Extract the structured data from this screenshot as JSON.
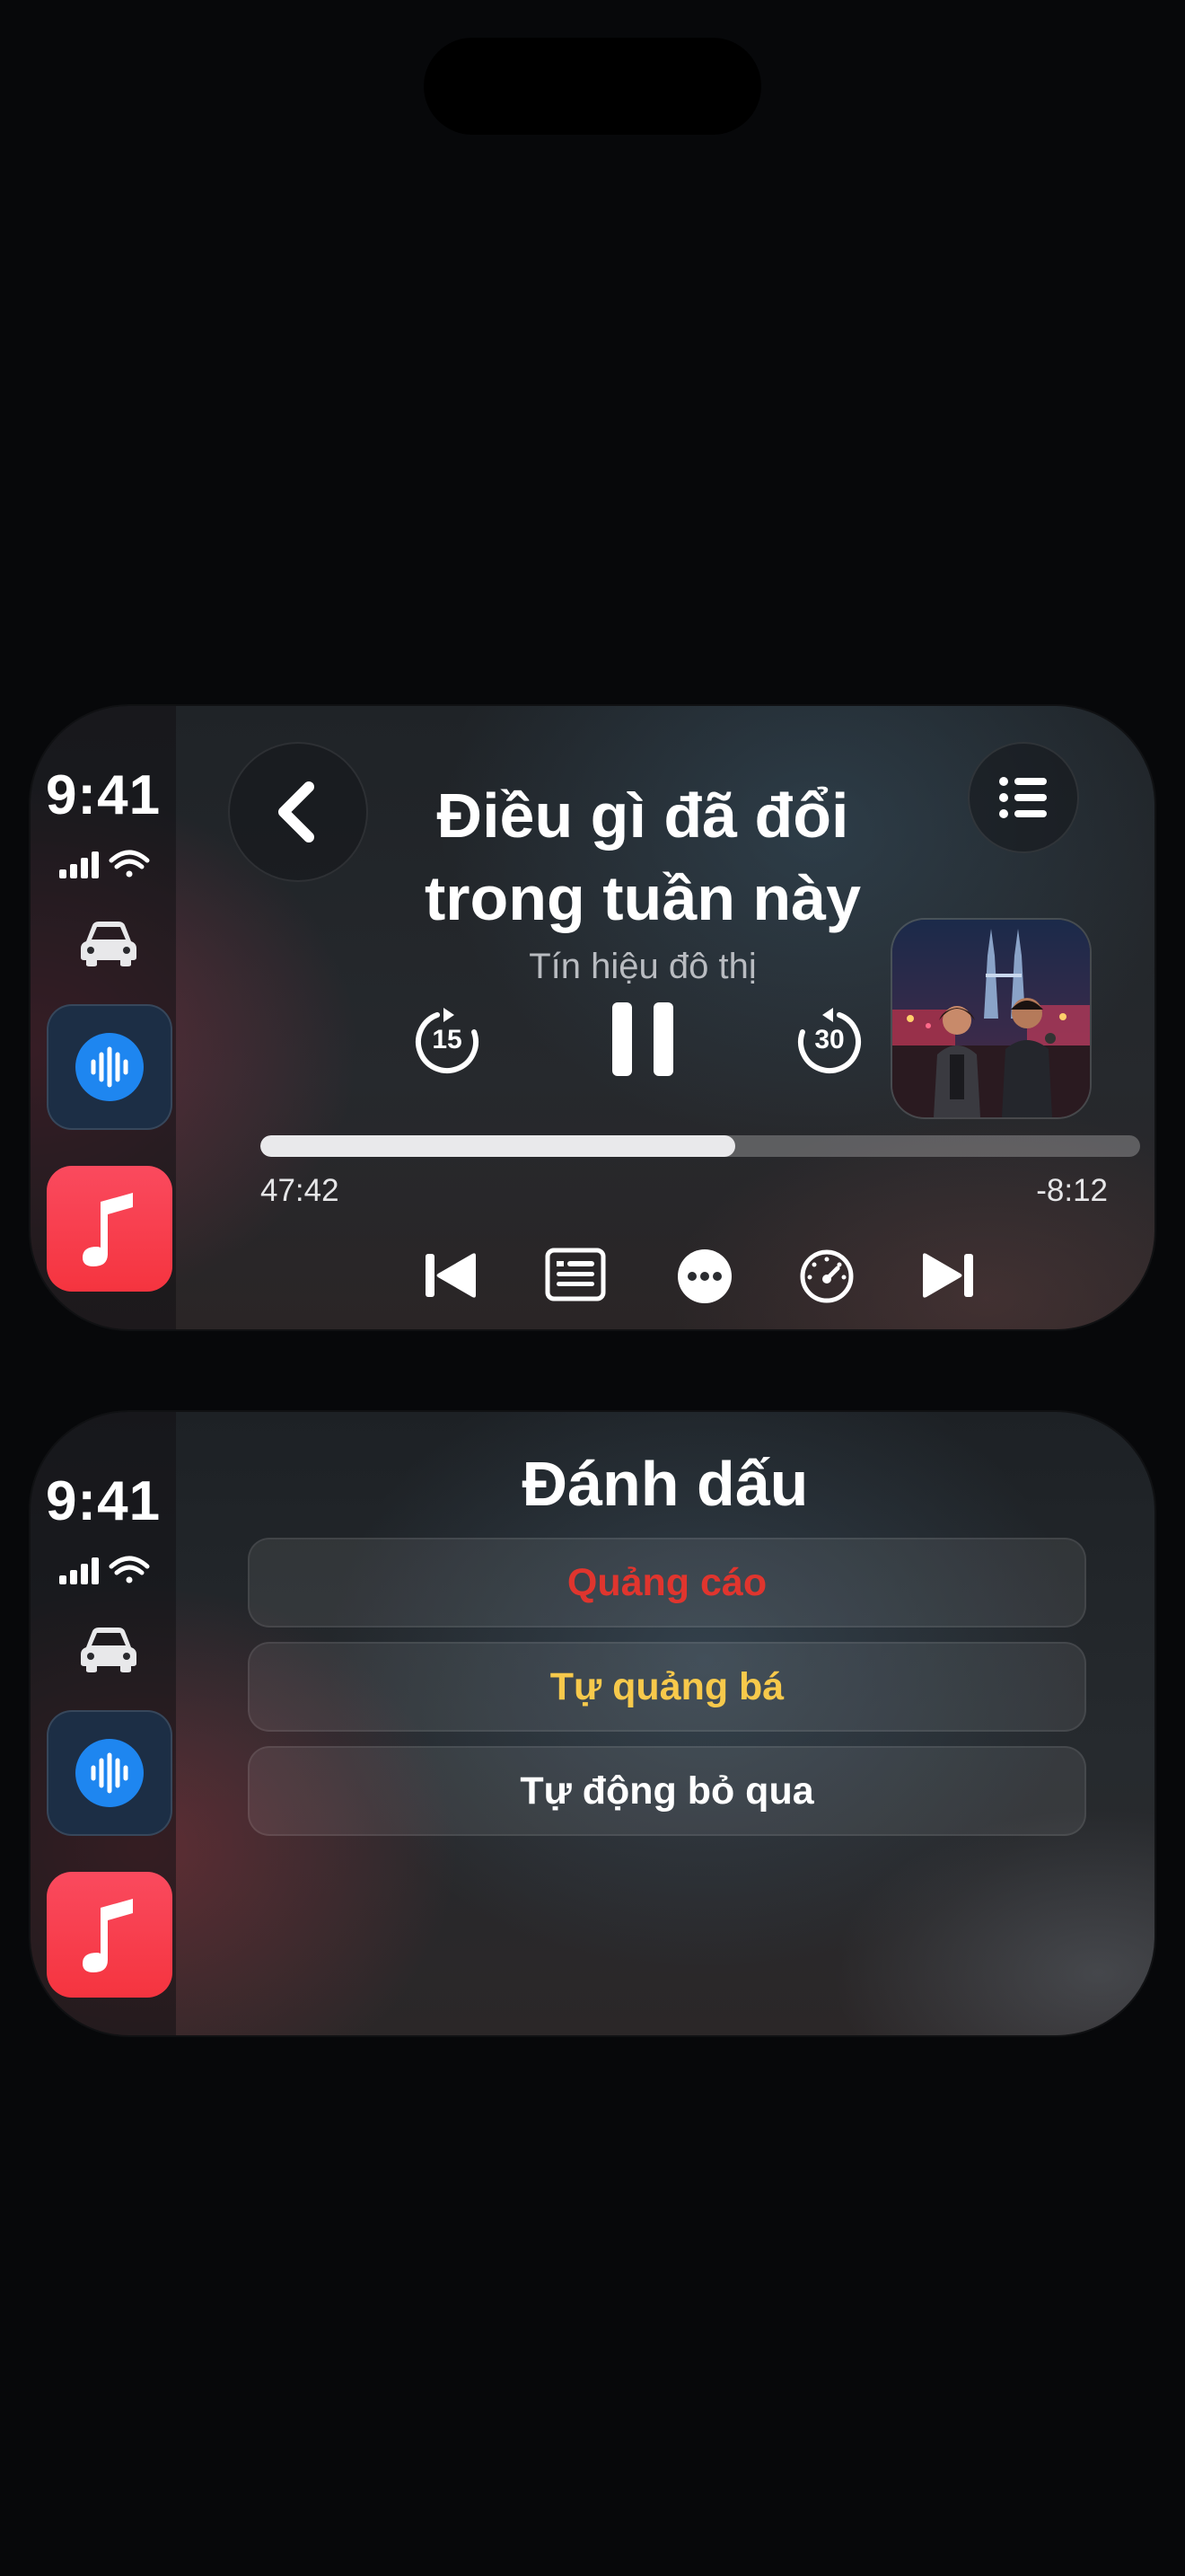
{
  "panels": [
    {
      "dock": {
        "time": "9:41"
      },
      "player": {
        "title_line1": "Điều gì đã đổi",
        "title_line2": "trong tuần này",
        "show": "Tín hiệu đô thị",
        "skip_back_seconds": "15",
        "skip_forward_seconds": "30",
        "elapsed": "47:42",
        "remaining": "-8:12",
        "progress_fraction": 0.54
      }
    },
    {
      "dock": {
        "time": "9:41"
      },
      "bookmark": {
        "title": "Đánh dấu",
        "items": [
          {
            "label": "Quảng cáo",
            "color": "#e0352e"
          },
          {
            "label": "Tự quảng bá",
            "color": "#f7c94b"
          },
          {
            "label": "Tự động bỏ qua",
            "color": "#ffffff"
          }
        ]
      }
    }
  ],
  "icons": {
    "dock": [
      "signal-icon",
      "wifi-icon",
      "car-icon",
      "podcast-app-icon",
      "music-app-icon"
    ],
    "player": [
      "back-icon",
      "queue-list-icon",
      "skip-back-15-icon",
      "pause-icon",
      "skip-forward-30-icon",
      "previous-track-icon",
      "transcript-icon",
      "more-icon",
      "playback-speed-icon",
      "next-track-icon"
    ]
  },
  "colors": {
    "podcast_app": "#1e86f0",
    "music_app": "#f5343f"
  }
}
